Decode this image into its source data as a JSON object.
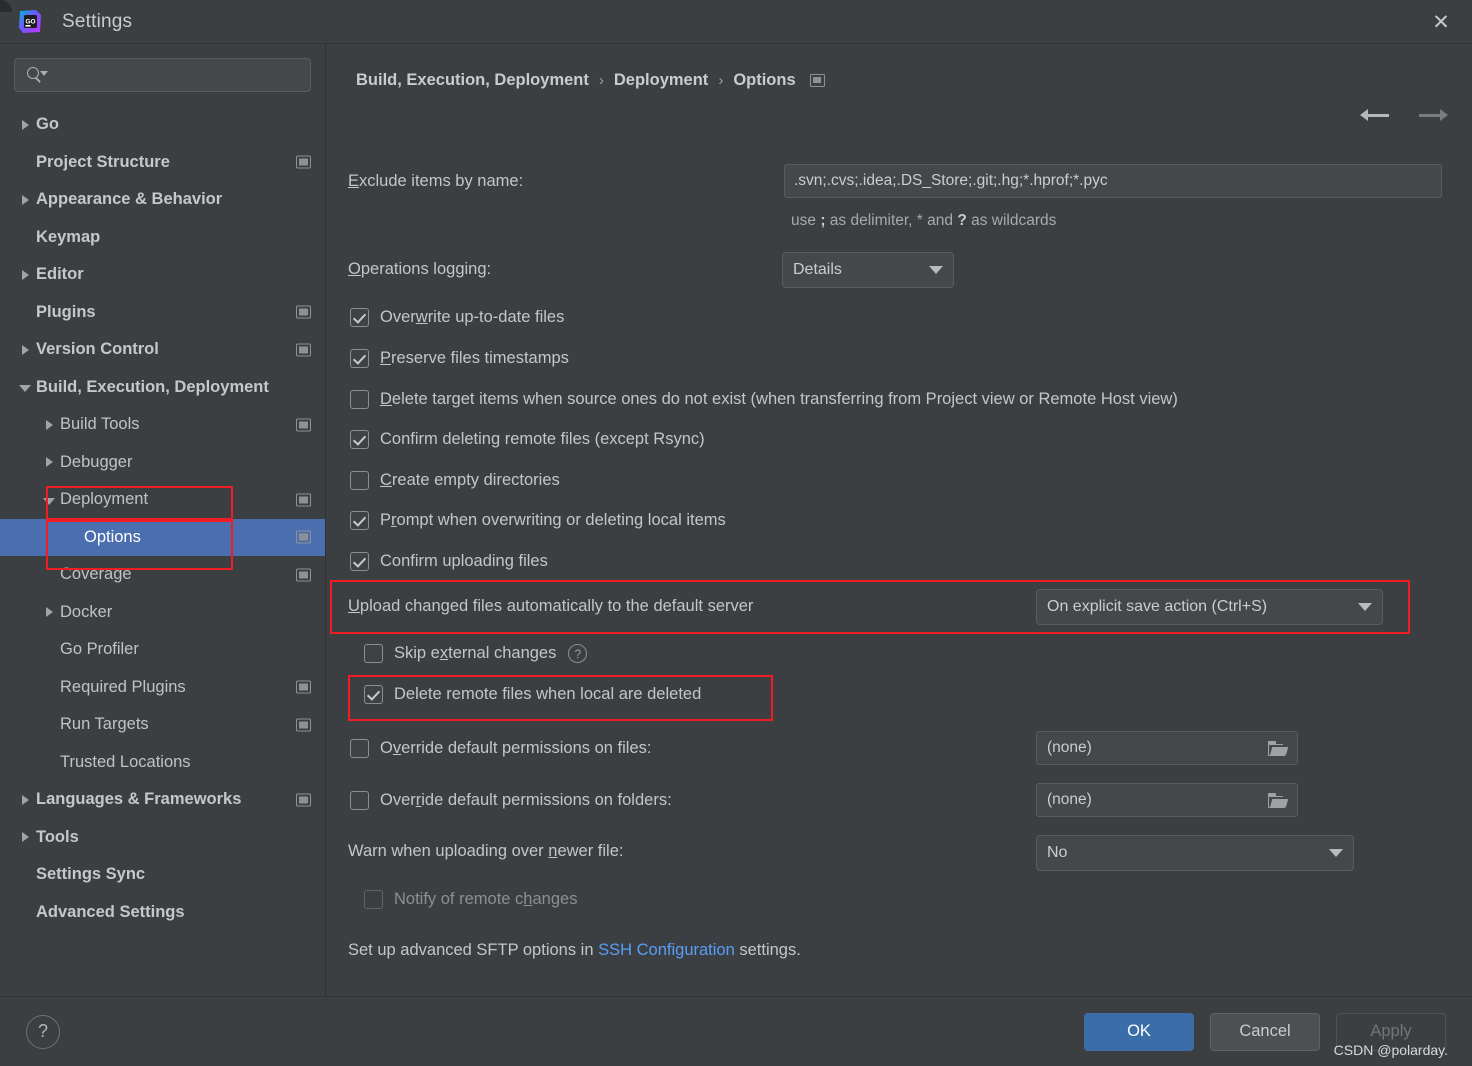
{
  "window": {
    "title": "Settings",
    "app_icon": "goland-icon",
    "close_label": "✕"
  },
  "sidebar": {
    "search": {
      "value": "",
      "placeholder": ""
    },
    "items": [
      {
        "label": "Go",
        "level": 0,
        "twisty": "collapsed",
        "bold": true,
        "scope_icon": false,
        "selected": false
      },
      {
        "label": "Project Structure",
        "level": 0,
        "twisty": "none",
        "bold": true,
        "scope_icon": true,
        "selected": false
      },
      {
        "label": "Appearance & Behavior",
        "level": 0,
        "twisty": "collapsed",
        "bold": true,
        "scope_icon": false,
        "selected": false
      },
      {
        "label": "Keymap",
        "level": 0,
        "twisty": "none",
        "bold": true,
        "scope_icon": false,
        "selected": false
      },
      {
        "label": "Editor",
        "level": 0,
        "twisty": "collapsed",
        "bold": true,
        "scope_icon": false,
        "selected": false
      },
      {
        "label": "Plugins",
        "level": 0,
        "twisty": "none",
        "bold": true,
        "scope_icon": true,
        "selected": false
      },
      {
        "label": "Version Control",
        "level": 0,
        "twisty": "collapsed",
        "bold": true,
        "scope_icon": true,
        "selected": false
      },
      {
        "label": "Build, Execution, Deployment",
        "level": 0,
        "twisty": "expanded",
        "bold": true,
        "scope_icon": false,
        "selected": false
      },
      {
        "label": "Build Tools",
        "level": 1,
        "twisty": "collapsed",
        "bold": false,
        "scope_icon": true,
        "selected": false
      },
      {
        "label": "Debugger",
        "level": 1,
        "twisty": "collapsed",
        "bold": false,
        "scope_icon": false,
        "selected": false
      },
      {
        "label": "Deployment",
        "level": 1,
        "twisty": "expanded",
        "bold": false,
        "scope_icon": true,
        "selected": false
      },
      {
        "label": "Options",
        "level": 2,
        "twisty": "none",
        "bold": false,
        "scope_icon": true,
        "selected": true
      },
      {
        "label": "Coverage",
        "level": 1,
        "twisty": "none",
        "bold": false,
        "scope_icon": true,
        "selected": false
      },
      {
        "label": "Docker",
        "level": 1,
        "twisty": "collapsed",
        "bold": false,
        "scope_icon": false,
        "selected": false
      },
      {
        "label": "Go Profiler",
        "level": 1,
        "twisty": "none",
        "bold": false,
        "scope_icon": false,
        "selected": false
      },
      {
        "label": "Required Plugins",
        "level": 1,
        "twisty": "none",
        "bold": false,
        "scope_icon": true,
        "selected": false
      },
      {
        "label": "Run Targets",
        "level": 1,
        "twisty": "none",
        "bold": false,
        "scope_icon": true,
        "selected": false
      },
      {
        "label": "Trusted Locations",
        "level": 1,
        "twisty": "none",
        "bold": false,
        "scope_icon": false,
        "selected": false
      },
      {
        "label": "Languages & Frameworks",
        "level": 0,
        "twisty": "collapsed",
        "bold": true,
        "scope_icon": true,
        "selected": false
      },
      {
        "label": "Tools",
        "level": 0,
        "twisty": "collapsed",
        "bold": true,
        "scope_icon": false,
        "selected": false
      },
      {
        "label": "Settings Sync",
        "level": 0,
        "twisty": "none",
        "bold": true,
        "scope_icon": false,
        "selected": false
      },
      {
        "label": "Advanced Settings",
        "level": 0,
        "twisty": "none",
        "bold": true,
        "scope_icon": false,
        "selected": false
      }
    ]
  },
  "breadcrumb": {
    "items": [
      "Build, Execution, Deployment",
      "Deployment",
      "Options"
    ],
    "separator": "›",
    "scope_icon": "project-scope-icon"
  },
  "nav": {
    "back": "back-arrow",
    "forward": "forward-arrow"
  },
  "main": {
    "exclude_label": "Exclude items by name:",
    "exclude_label_mnemonic": "E",
    "exclude_value": ".svn;.cvs;.idea;.DS_Store;.git;.hg;*.hprof;*.pyc",
    "exclude_hint_pre": "use ",
    "exclude_hint_delim": ";",
    "exclude_hint_mid": " as delimiter, * and ",
    "exclude_hint_wild": "?",
    "exclude_hint_post": " as wildcards",
    "operations_logging_label": "Operations logging:",
    "operations_logging_mnemonic": "O",
    "operations_logging_value": "Details",
    "checkboxes": [
      {
        "label": "Overwrite up-to-date files",
        "mnemonic": "w",
        "checked": true,
        "enabled": true
      },
      {
        "label": "Preserve files timestamps",
        "mnemonic": "P",
        "checked": true,
        "enabled": true
      },
      {
        "label": "Delete target items when source ones do not exist (when transferring from Project view or Remote Host view)",
        "mnemonic": "D",
        "checked": false,
        "enabled": true
      },
      {
        "label": "Confirm deleting remote files (except Rsync)",
        "mnemonic": "",
        "checked": true,
        "enabled": true
      },
      {
        "label": "Create empty directories",
        "mnemonic": "C",
        "checked": false,
        "enabled": true
      },
      {
        "label": "Prompt when overwriting or deleting local items",
        "mnemonic": "r",
        "checked": true,
        "enabled": true
      },
      {
        "label": "Confirm uploading files",
        "mnemonic": "",
        "checked": true,
        "enabled": true
      }
    ],
    "upload_label": "Upload changed files automatically to the default server",
    "upload_label_mnemonic": "U",
    "upload_value": "On explicit save action (Ctrl+S)",
    "skip_external_label": "Skip external changes",
    "skip_external_mnemonic": "x",
    "skip_external_checked": false,
    "help_icon_glyph": "?",
    "delete_remote_label": "Delete remote files when local are deleted",
    "delete_remote_checked": true,
    "override_files_label": "Override default permissions on files:",
    "override_files_mnemonic": "v",
    "override_files_checked": false,
    "override_files_value": "(none)",
    "override_folders_label": "Override default permissions on folders:",
    "override_folders_mnemonic": "i",
    "override_folders_checked": false,
    "override_folders_value": "(none)",
    "warn_label": "Warn when uploading over newer file:",
    "warn_label_mnemonic": "n",
    "warn_value": "No",
    "notify_label": "Notify of remote changes",
    "notify_mnemonic": "h",
    "notify_checked": false,
    "notify_enabled": false,
    "sftp_text_pre": "Set up advanced SFTP options in ",
    "sftp_link": "SSH Configuration",
    "sftp_text_post": " settings.",
    "browse_icon": "folder-open-icon"
  },
  "footer": {
    "help_glyph": "?",
    "ok_label": "OK",
    "cancel_label": "Cancel",
    "apply_label": "Apply",
    "watermark": "CSDN @polarday."
  },
  "colors": {
    "selection_blue": "#4b6eaf",
    "highlight_red": "#ef1c24",
    "primary_button": "#3b6ea8",
    "link_blue": "#589df6",
    "panel_bg": "#3c3f41"
  }
}
